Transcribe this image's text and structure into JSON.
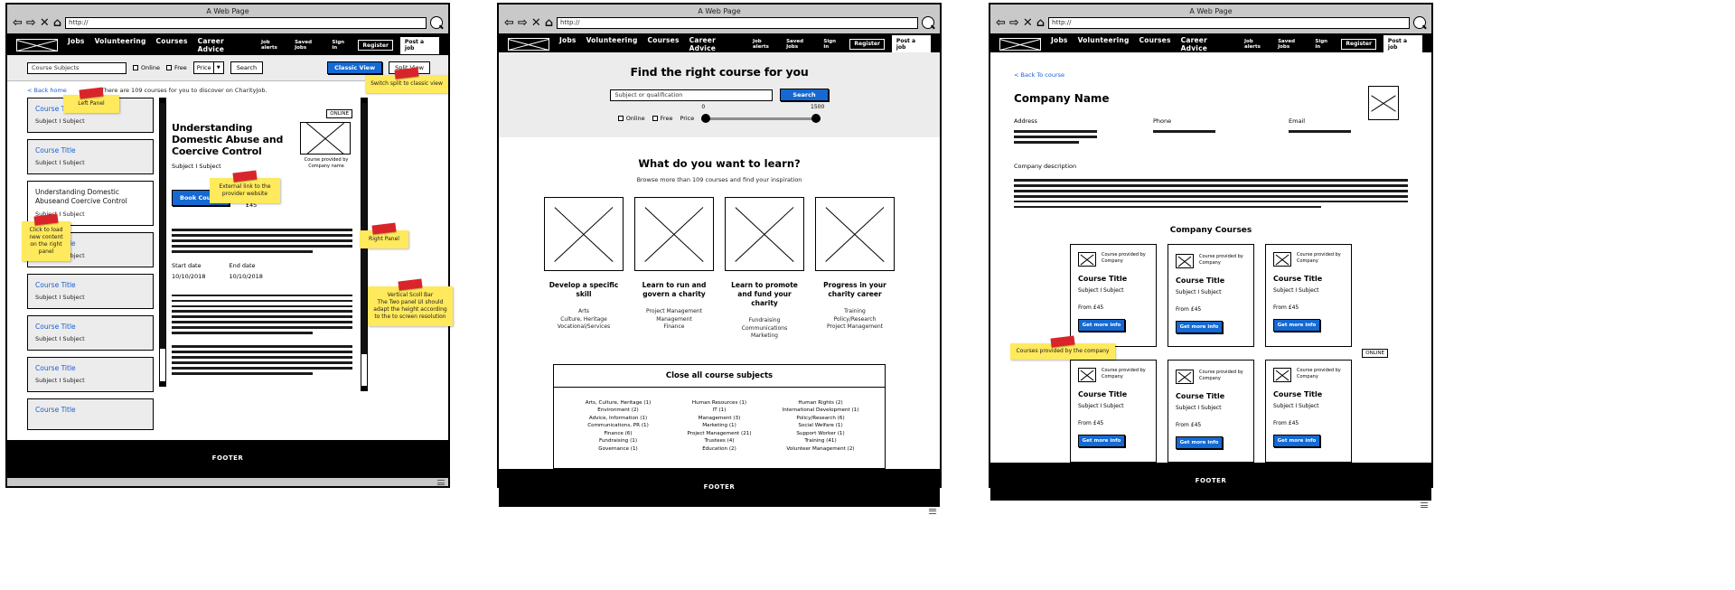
{
  "browser": {
    "title": "A Web Page",
    "url": "http://",
    "icons": {
      "back": "back-arrow-icon",
      "forward": "forward-arrow-icon",
      "close": "close-icon",
      "home": "home-icon",
      "search": "search-icon"
    }
  },
  "site_nav": {
    "logo": "site-logo",
    "items": [
      "Jobs",
      "Volunteering",
      "Courses",
      "Career Advice"
    ],
    "utility": [
      "Job alerts",
      "Saved Jobs",
      "Sign in"
    ],
    "register": "Register",
    "post_job": "Post a job"
  },
  "panel1": {
    "search": {
      "subject_value": "Course Subjects",
      "online_label": "Online",
      "free_label": "Free",
      "price_label": "Price",
      "search_button": "Search",
      "classic_view": "Classic View",
      "split_view": "Split View"
    },
    "back_home": "< Back home",
    "results_text": "There are 109 courses for you to discover on CharityJob.",
    "cards": [
      {
        "title": "Course Title",
        "subjects": "Subject  I  Subject",
        "style": "grey"
      },
      {
        "title": "Course Title",
        "subjects": "Subject  I  Subject",
        "style": "grey"
      },
      {
        "title": "Understanding Domestic Abuseand Coercive Control",
        "subjects": "Subject   I   Subject",
        "style": "white"
      },
      {
        "title": "Course Title",
        "subjects": "Subject  I  Subject",
        "style": "grey"
      },
      {
        "title": "Course Title",
        "subjects": "Subject  I  Subject",
        "style": "grey"
      },
      {
        "title": "Course Title",
        "subjects": "Subject  I  Subject",
        "style": "grey"
      },
      {
        "title": "Course Title",
        "subjects": "Subject  I  Subject",
        "style": "grey"
      },
      {
        "title": "Course Title",
        "subjects": "",
        "style": "grey"
      }
    ],
    "detail": {
      "online_tag": "ONLINE",
      "title": "Understanding Domestic Abuse and Coercive Control",
      "subjects": "Subject   I   Subject",
      "thumb_caption": "Course provided by\nCompany name",
      "book_button": "Book Course",
      "cost_label": "Cost",
      "cost_value": "£45",
      "start_label": "Start date",
      "start_value": "10/10/2018",
      "end_label": "End date",
      "end_value": "10/10/2018"
    },
    "notes": {
      "left_panel": "Left Panel",
      "switch_view": "Switch split to classic view",
      "external_link": "External link to the provider website",
      "click_load": "Click to load new content on the right panel",
      "right_panel": "Right Panel",
      "scroll_bar": "Vertical Scoll Bar\nThe Two panel UI should adapt the height according to the to screen resolution"
    },
    "footer": "FOOTER"
  },
  "panel2": {
    "hero": {
      "heading": "Find the right course for you",
      "field_placeholder": "Subject or qualification",
      "search_button": "Search",
      "online_label": "Online",
      "free_label": "Free",
      "price_label": "Price",
      "price_min": "0",
      "price_max": "1500"
    },
    "section": {
      "heading": "What do you want to learn?",
      "sub": "Browse more than 109 courses and find your inspiration",
      "cells": [
        {
          "title": "Develop a specific skill",
          "links": [
            "Arts",
            "Culture, Heritage",
            "Vocational/Services"
          ]
        },
        {
          "title": "Learn to run and govern a charity",
          "links": [
            "Project Management",
            "Management",
            "Finance"
          ]
        },
        {
          "title": "Learn to promote and fund your charity",
          "links": [
            "Fundraising",
            "Communications",
            "Marketing"
          ]
        },
        {
          "title": "Progress in your charity career",
          "links": [
            "Training",
            "Policy/Research",
            "Project Management"
          ]
        }
      ]
    },
    "subjects": {
      "heading": "Close all course subjects",
      "columns": [
        [
          "Arts, Culture, Heritage (1)",
          "Environment (2)",
          "Advice, Information (1)",
          "Communications, PR (1)",
          "Finance (6)",
          "Fundraising (1)",
          "Governance (1)"
        ],
        [
          "Human Resources (1)",
          "IT (1)",
          "Management (3)",
          "Marketing (1)",
          "Project Management (21)",
          "Trustees (4)",
          "Education (2)"
        ],
        [
          "Human Rights (2)",
          "International Development (1)",
          "Policy/Research (6)",
          "Social Welfare (1)",
          "Support Worker (1)",
          "Training (41)",
          "Volunteer Management (2)"
        ]
      ]
    },
    "footer": "FOOTER"
  },
  "panel3": {
    "back_link": "< Back To course",
    "company_name": "Company Name",
    "meta": [
      {
        "label": "Address",
        "lines": 3
      },
      {
        "label": "Phone",
        "lines": 1
      },
      {
        "label": "Email",
        "lines": 1
      }
    ],
    "description_label": "Company description",
    "courses_heading": "Company Courses",
    "online_tag": "ONLINE",
    "note": "Courses provided by the company",
    "cards": [
      {
        "provider": "Course provided by Company",
        "title": "Course Title",
        "subjects": "Subject   I   Subject",
        "from": "From £45",
        "button": "Get more info"
      },
      {
        "provider": "Course provided by Company",
        "title": "Course Title",
        "subjects": "Subject   I   Subject",
        "from": "From £45",
        "button": "Get more info"
      },
      {
        "provider": "Course provided by Company",
        "title": "Course Title",
        "subjects": "Subject   I   Subject",
        "from": "From £45",
        "button": "Get more info"
      },
      {
        "provider": "Course provided by Company",
        "title": "Course Title",
        "subjects": "Subject   I   Subject",
        "from": "From £45",
        "button": "Get more info"
      },
      {
        "provider": "Course provided by Company",
        "title": "Course Title",
        "subjects": "Subject   I   Subject",
        "from": "From £45",
        "button": "Get more info"
      },
      {
        "provider": "Course provided by Company",
        "title": "Course Title",
        "subjects": "Subject   I   Subject",
        "from": "From £45",
        "button": "Get more info"
      }
    ],
    "footer": "FOOTER"
  },
  "colors": {
    "accent_blue": "#1469d2",
    "link_blue": "#1a5fd0",
    "sticky_yellow": "#ffe95c",
    "tape_red": "#d9252a",
    "header_black": "#000000",
    "strip_grey": "#ececec"
  }
}
